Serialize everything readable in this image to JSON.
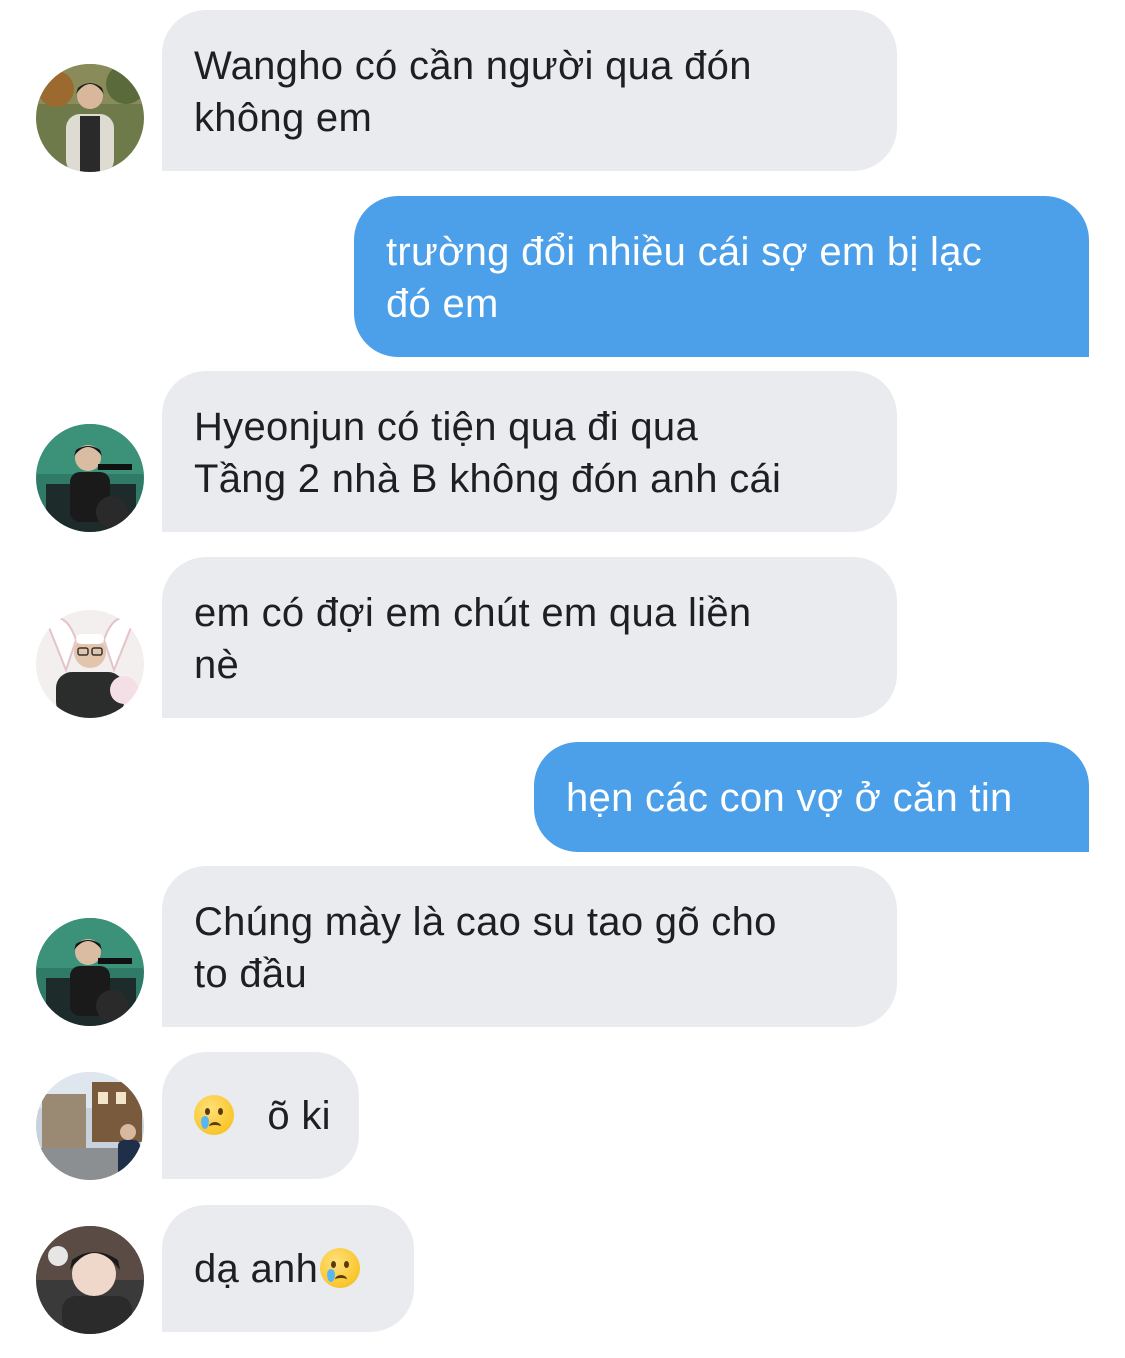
{
  "messages": [
    {
      "sender": "Wangho",
      "lines": [
        "Wangho có cần người qua đón",
        "không em"
      ]
    },
    {
      "sender": "me",
      "lines": [
        "trường đổi nhiều cái sợ em bị lạc",
        "đó em"
      ]
    },
    {
      "sender": "Hyeonjun",
      "lines": [
        "Hyeonjun có tiện qua đi qua",
        "Tầng 2 nhà B không đón anh cái"
      ]
    },
    {
      "sender": "contact-3",
      "lines": [
        "em có đợi em chút em qua liền",
        "nè"
      ]
    },
    {
      "sender": "me",
      "lines": [
        "hẹn các con vợ ở căn tin"
      ]
    },
    {
      "sender": "Hyeonjun",
      "lines": [
        "Chúng mày là cao su tao gõ cho",
        "to đầu"
      ]
    },
    {
      "sender": "contact-5",
      "emoji": "crying-face-emoji",
      "text": "õ ki"
    },
    {
      "sender": "contact-6",
      "text": "dạ anh",
      "emoji": "crying-face-emoji"
    }
  ],
  "colors": {
    "incoming_bubble": "#e9ebef",
    "outgoing_bubble": "#4c9fe9",
    "incoming_text": "#1f1f21",
    "outgoing_text": "#ffffff",
    "background": "#ffffff"
  }
}
